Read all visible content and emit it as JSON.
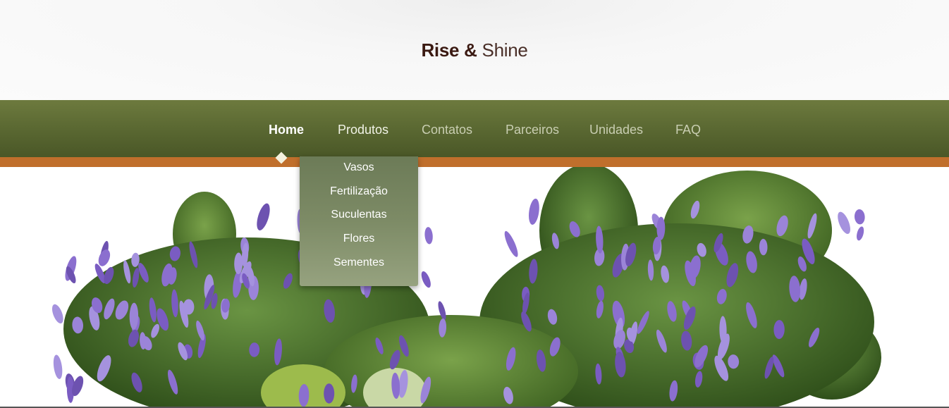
{
  "header": {
    "logo_bold": "Rise",
    "logo_amp": "&",
    "logo_light": "Shine"
  },
  "nav": {
    "items": [
      {
        "label": "Home"
      },
      {
        "label": "Produtos"
      },
      {
        "label": "Contatos"
      },
      {
        "label": "Parceiros"
      },
      {
        "label": "Unidades"
      },
      {
        "label": "FAQ"
      }
    ],
    "active_index": 0
  },
  "dropdown": {
    "items": [
      {
        "label": "Vasos"
      },
      {
        "label": "Fertilização"
      },
      {
        "label": "Suculentas"
      },
      {
        "label": "Flores"
      },
      {
        "label": "Sementes"
      }
    ]
  },
  "colors": {
    "navbar": "#5c6a33",
    "accent_stripe": "#c06f2c",
    "logo_text": "#3b1a12",
    "flower_purple": "#8b6fcf",
    "foliage_green": "#4f7a2e"
  },
  "hero": {
    "image": "lilac-flower-bushes"
  }
}
